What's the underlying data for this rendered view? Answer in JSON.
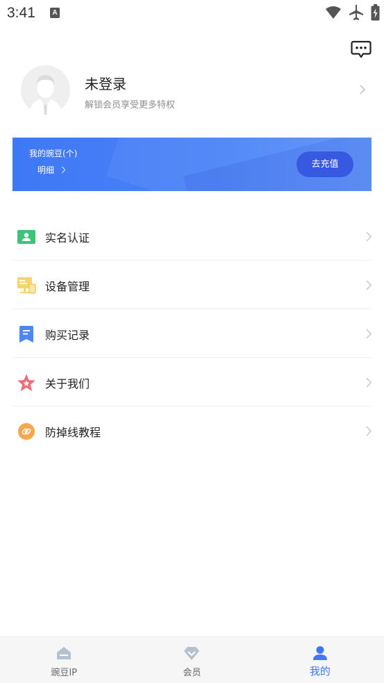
{
  "status_bar": {
    "time": "3:41",
    "badge": "A"
  },
  "profile": {
    "name": "未登录",
    "subtitle": "解锁会员享受更多特权"
  },
  "banner": {
    "title": "我的豌豆(个)",
    "detail": "明细",
    "button": "去充值"
  },
  "menu": [
    {
      "label": "实名认证",
      "icon": "id-card-icon"
    },
    {
      "label": "设备管理",
      "icon": "devices-icon"
    },
    {
      "label": "购买记录",
      "icon": "receipt-icon"
    },
    {
      "label": "关于我们",
      "icon": "star-icon"
    },
    {
      "label": "防掉线教程",
      "icon": "link-icon"
    }
  ],
  "nav": [
    {
      "label": "豌豆IP",
      "icon": "home-icon",
      "active": false
    },
    {
      "label": "会员",
      "icon": "diamond-icon",
      "active": false
    },
    {
      "label": "我的",
      "icon": "user-icon",
      "active": true
    }
  ],
  "colors": {
    "accent": "#3f78f5",
    "button": "#3659df",
    "inactive": "#666666"
  }
}
